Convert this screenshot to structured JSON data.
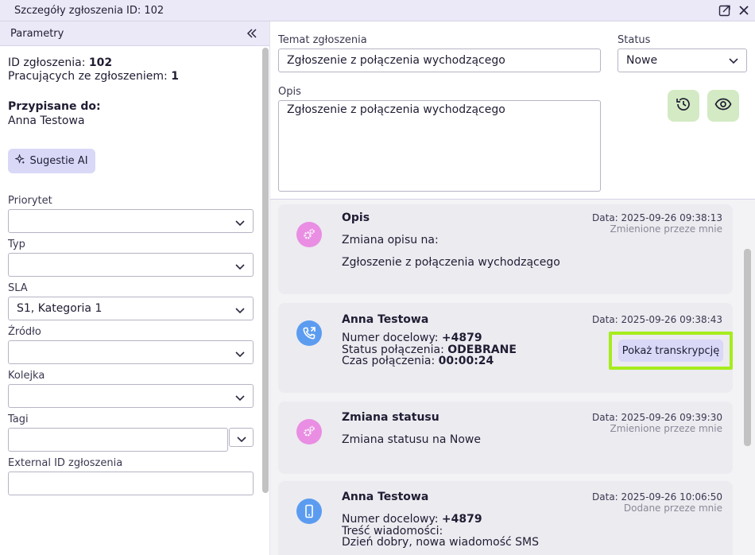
{
  "window": {
    "title": "Szczegóły zgłoszenia ID: 102"
  },
  "left_panel": {
    "header": "Parametry",
    "ticket_id_label": "ID zgłoszenia:",
    "ticket_id": "102",
    "working_label": "Pracujących ze zgłoszeniem:",
    "working_count": "1",
    "assigned_label": "Przypisane do:",
    "assigned_to": "Anna Testowa",
    "ai_button": "Sugestie AI",
    "fields": {
      "priority": {
        "label": "Priorytet",
        "value": ""
      },
      "type": {
        "label": "Typ",
        "value": ""
      },
      "sla": {
        "label": "SLA",
        "value": "S1, Kategoria 1"
      },
      "source": {
        "label": "Źródło",
        "value": ""
      },
      "queue": {
        "label": "Kolejka",
        "value": ""
      },
      "tags": {
        "label": "Tagi",
        "value": ""
      },
      "external_id": {
        "label": "External ID zgłoszenia",
        "value": ""
      }
    }
  },
  "form": {
    "subject_label": "Temat zgłoszenia",
    "subject_value": "Zgłoszenie z połączenia wychodzącego",
    "status_label": "Status",
    "status_value": "Nowe",
    "description_label": "Opis",
    "description_value": "Zgłoszenie z połączenia wychodzącego"
  },
  "timeline": [
    {
      "title": "Opis",
      "date": "Data: 2025-09-26 09:38:13",
      "by": "Zmienione przeze mnie",
      "line1": "Zmiana opisu na:",
      "line2": "Zgłoszenie z połączenia wychodzącego"
    },
    {
      "title": "Anna Testowa",
      "date": "Data: 2025-09-26 09:38:43",
      "target_label": "Numer docelowy:",
      "target_value": "+4879",
      "status_label": "Status połączenia:",
      "status_value": "ODEBRANE",
      "time_label": "Czas połączenia:",
      "time_value": "00:00:24",
      "transcript_button": "Pokaż transkrypcję"
    },
    {
      "title": "Zmiana statusu",
      "date": "Data: 2025-09-26 09:39:30",
      "by": "Zmienione przeze mnie",
      "line1": "Zmiana statusu na Nowe"
    },
    {
      "title": "Anna Testowa",
      "date": "Data: 2025-09-26 10:06:50",
      "by": "Dodane przeze mnie",
      "target_label": "Numer docelowy:",
      "target_value": "+4879",
      "content_label": "Treść wiadomości:",
      "content_value": "Dzień dobry, nowa wiadomość SMS"
    }
  ],
  "colors": {
    "accent_purple": "#d9d8f7",
    "highlight_green": "#a6ec1c",
    "action_green": "#d3eac4",
    "avatar_pink": "#e98ee3",
    "avatar_blue": "#5b9cf0"
  }
}
